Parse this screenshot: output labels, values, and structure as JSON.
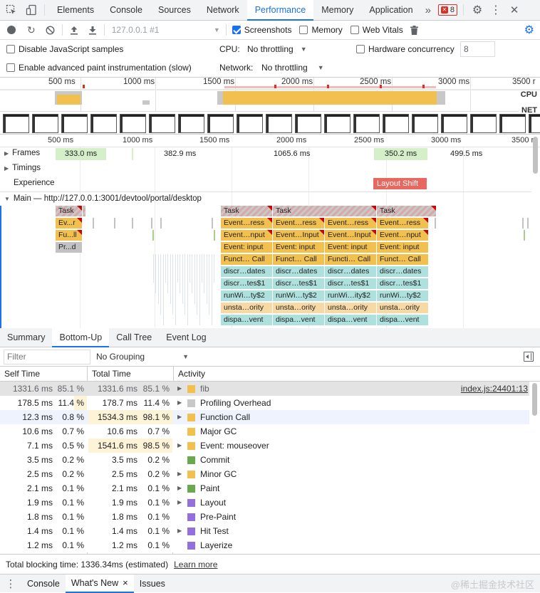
{
  "tabs": {
    "panels": [
      "Elements",
      "Console",
      "Sources",
      "Network",
      "Performance",
      "Memory",
      "Application"
    ],
    "active": "Performance",
    "more": "»",
    "error_count": "8"
  },
  "toolbar": {
    "url": "127.0.0.1 #1",
    "screenshots_label": "Screenshots",
    "memory_label": "Memory",
    "web_vitals_label": "Web Vitals"
  },
  "settings": {
    "disable_js_label": "Disable JavaScript samples",
    "paint_label": "Enable advanced paint instrumentation (slow)",
    "cpu_label": "CPU:",
    "cpu_value": "No throttling",
    "network_label": "Network:",
    "network_value": "No throttling",
    "hw_label": "Hardware concurrency",
    "hw_value": "8"
  },
  "overview": {
    "ticks": [
      "500 ms",
      "1000 ms",
      "1500 ms",
      "2000 ms",
      "2500 ms",
      "3000 ms",
      "3500 r"
    ],
    "cpu_label": "CPU",
    "net_label": "NET"
  },
  "timeline": {
    "ticks": [
      "500 ms",
      "1000 ms",
      "1500 ms",
      "2000 ms",
      "2500 ms",
      "3000 ms",
      "3500 r"
    ],
    "frames_label": "Frames",
    "frames": [
      "333.0 ms",
      "382.9 ms",
      "1065.6 ms",
      "350.2 ms",
      "499.5 ms"
    ],
    "timings_label": "Timings",
    "experience_label": "Experience",
    "layout_shift": "Layout Shift",
    "main_label": "Main — http://127.0.0.1:3001/devtool/portal/desktop",
    "flame_small": [
      "Task",
      "Ev...r",
      "Fu...ll",
      "Pr...d"
    ],
    "flame_cols": [
      [
        "Task",
        "Event…ress",
        "Event…nput",
        "Event: input",
        "Funct… Call",
        "discr…dates",
        "discr…tes$1",
        "runWi…ty$2",
        "unsta…ority",
        "dispa…vent"
      ],
      [
        "Task",
        "Event…ress",
        "Event…Input",
        "Event: input",
        "Funct… Call",
        "discr…dates",
        "discr…tes$1",
        "runWi…ty$2",
        "unsta…ority",
        "dispa…vent"
      ],
      [
        "",
        "Event…ress",
        "Event…Input",
        "Event: input",
        "Functi… Call",
        "discr…dates",
        "discr…tes$1",
        "runWi…ity$2",
        "unsta…ority",
        "dispa…vent"
      ],
      [
        "Task",
        "Event…ress",
        "Event…nput",
        "Event: input",
        "Funct… Call",
        "discr…dates",
        "discr…tes$1",
        "runWi…ty$2",
        "unsta…ority",
        "dispa…vent"
      ]
    ]
  },
  "bottom": {
    "tabs": [
      "Summary",
      "Bottom-Up",
      "Call Tree",
      "Event Log"
    ],
    "active": "Bottom-Up",
    "filter_placeholder": "Filter",
    "grouping": "No Grouping",
    "col_self": "Self Time",
    "col_total": "Total Time",
    "col_activity": "Activity",
    "rows": [
      {
        "self": "1331.6 ms",
        "self_pct": "85.1 %",
        "total": "1331.6 ms",
        "total_pct": "85.1 %",
        "name": "fib",
        "color": "#f2c04f",
        "expand": true,
        "link": "index.js:24401:13"
      },
      {
        "self": "178.5 ms",
        "self_pct": "11.4 %",
        "total": "178.7 ms",
        "total_pct": "11.4 %",
        "name": "Profiling Overhead",
        "color": "#c8c8c8",
        "expand": true,
        "link": ""
      },
      {
        "self": "12.3 ms",
        "self_pct": "0.8 %",
        "total": "1534.3 ms",
        "total_pct": "98.1 %",
        "name": "Function Call",
        "color": "#f2c04f",
        "expand": true,
        "link": ""
      },
      {
        "self": "10.6 ms",
        "self_pct": "0.7 %",
        "total": "10.6 ms",
        "total_pct": "0.7 %",
        "name": "Major GC",
        "color": "#f2c04f",
        "expand": false,
        "link": ""
      },
      {
        "self": "7.1 ms",
        "self_pct": "0.5 %",
        "total": "1541.6 ms",
        "total_pct": "98.5 %",
        "name": "Event: mouseover",
        "color": "#f2c04f",
        "expand": true,
        "link": ""
      },
      {
        "self": "3.5 ms",
        "self_pct": "0.2 %",
        "total": "3.5 ms",
        "total_pct": "0.2 %",
        "name": "Commit",
        "color": "#6aa84f",
        "expand": false,
        "link": ""
      },
      {
        "self": "2.5 ms",
        "self_pct": "0.2 %",
        "total": "2.5 ms",
        "total_pct": "0.2 %",
        "name": "Minor GC",
        "color": "#f2c04f",
        "expand": true,
        "link": ""
      },
      {
        "self": "2.1 ms",
        "self_pct": "0.1 %",
        "total": "2.1 ms",
        "total_pct": "0.1 %",
        "name": "Paint",
        "color": "#6aa84f",
        "expand": true,
        "link": ""
      },
      {
        "self": "1.9 ms",
        "self_pct": "0.1 %",
        "total": "1.9 ms",
        "total_pct": "0.1 %",
        "name": "Layout",
        "color": "#9370db",
        "expand": true,
        "link": ""
      },
      {
        "self": "1.8 ms",
        "self_pct": "0.1 %",
        "total": "1.8 ms",
        "total_pct": "0.1 %",
        "name": "Pre-Paint",
        "color": "#9370db",
        "expand": false,
        "link": ""
      },
      {
        "self": "1.4 ms",
        "self_pct": "0.1 %",
        "total": "1.4 ms",
        "total_pct": "0.1 %",
        "name": "Hit Test",
        "color": "#9370db",
        "expand": true,
        "link": ""
      },
      {
        "self": "1.2 ms",
        "self_pct": "0.1 %",
        "total": "1.2 ms",
        "total_pct": "0.1 %",
        "name": "Layerize",
        "color": "#9370db",
        "expand": false,
        "link": ""
      }
    ]
  },
  "status": {
    "blocking": "Total blocking time: 1336.34ms (estimated)",
    "learn_more": "Learn more"
  },
  "drawer": {
    "tabs": [
      "Console",
      "What's New",
      "Issues"
    ],
    "active": "What's New",
    "close": "×",
    "watermark": "@稀土掘金技术社区"
  }
}
